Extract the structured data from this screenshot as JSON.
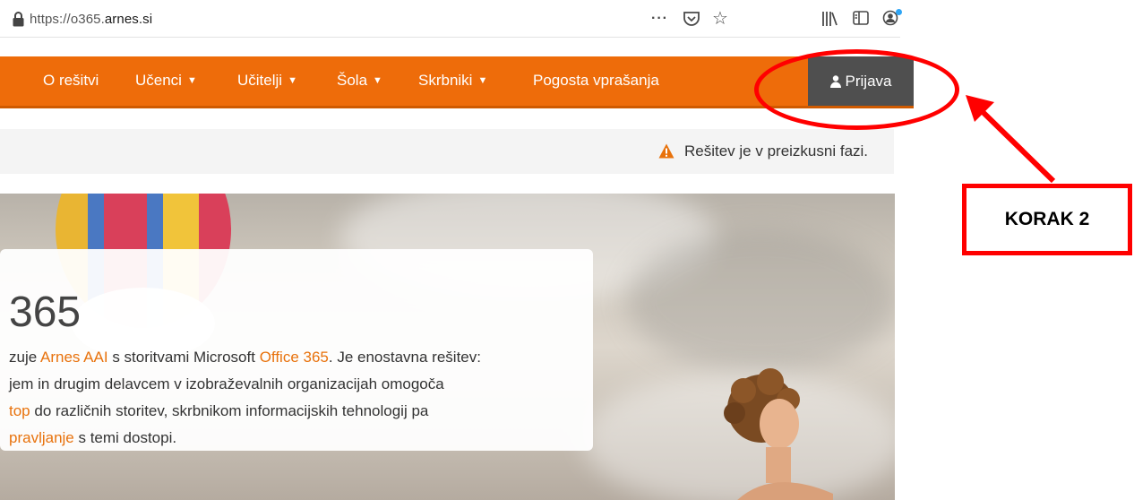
{
  "browser": {
    "url_prefix": "https://o365.",
    "url_domain": "arnes.si",
    "icons": [
      "lock-icon",
      "more-actions-icon",
      "pocket-icon",
      "bookmark-star-icon",
      "library-icon",
      "sidebar-icon",
      "account-icon"
    ]
  },
  "nav": {
    "items": [
      {
        "label": "O rešitvi",
        "dropdown": false
      },
      {
        "label": "Učenci",
        "dropdown": true
      },
      {
        "label": "Učitelji",
        "dropdown": true
      },
      {
        "label": "Šola",
        "dropdown": true
      },
      {
        "label": "Skrbniki",
        "dropdown": true
      },
      {
        "label": "Pogosta vprašanja",
        "dropdown": false
      }
    ],
    "login_label": "Prijava",
    "brand_color": "#ee6c0a",
    "login_bg": "#4f4f4f"
  },
  "notice": {
    "text": "Rešitev je v preizkusni fazi.",
    "icon": "warning-icon"
  },
  "hero": {
    "title": "365",
    "lines": [
      [
        "zuje ",
        {
          "hl": "Arnes AAI"
        },
        " s storitvami Microsoft ",
        {
          "hl": "Office 365"
        },
        ". Je enostavna rešitev:"
      ],
      [
        "jem in drugim delavcem v izobraževalnih organizacijah omogoča"
      ],
      [
        {
          "hl": "top"
        },
        " do različnih storitev, skrbnikom informacijskih tehnologij pa"
      ],
      [
        {
          "hl": "pravljanje"
        },
        " s temi dostopi."
      ]
    ],
    "highlight_color": "#e8720c"
  },
  "annotation": {
    "label": "KORAK 2",
    "color": "#ff0000"
  }
}
